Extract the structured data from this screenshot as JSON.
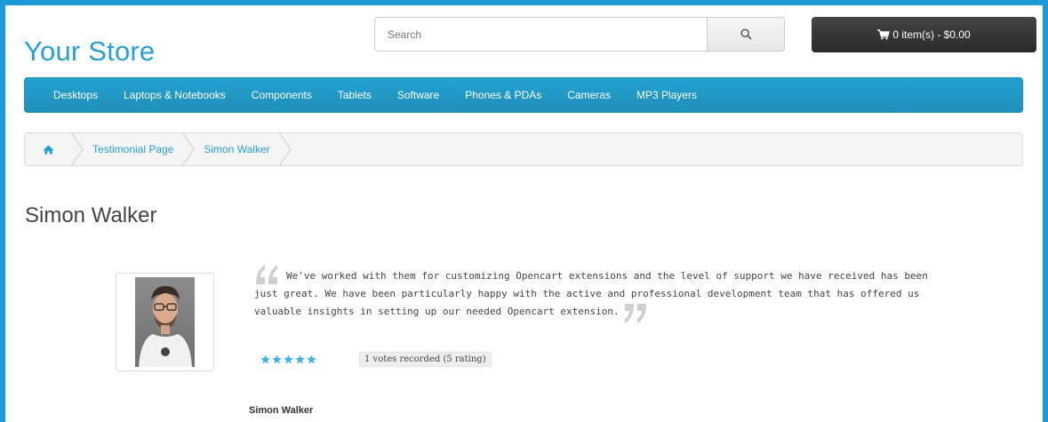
{
  "store": {
    "title": "Your Store"
  },
  "search": {
    "placeholder": "Search"
  },
  "cart": {
    "label": "0 item(s) - $0.00"
  },
  "nav": {
    "items": [
      "Desktops",
      "Laptops & Notebooks",
      "Components",
      "Tablets",
      "Software",
      "Phones & PDAs",
      "Cameras",
      "MP3 Players"
    ]
  },
  "breadcrumb": {
    "items": [
      "Testimonial Page",
      "Simon Walker"
    ]
  },
  "page": {
    "title": "Simon Walker"
  },
  "testimonial": {
    "text": "We've worked with them for customizing Opencart extensions and the level of support we have received has been just great. We have been particularly happy with the active and professional development team that has offered us valuable insights in setting up our needed Opencart extension.",
    "stars": 5,
    "votes": "1 votes recorded (5 rating)",
    "author": "Simon Walker"
  },
  "colors": {
    "accent": "#23a1d1",
    "star": "#3ab4e6",
    "quote_mark": "#cfcfcf"
  },
  "icons": {
    "search": "search-icon",
    "cart": "cart-icon",
    "home": "home-icon",
    "star": "star-icon",
    "quote_open": "quote-open-icon",
    "quote_close": "quote-close-icon"
  }
}
